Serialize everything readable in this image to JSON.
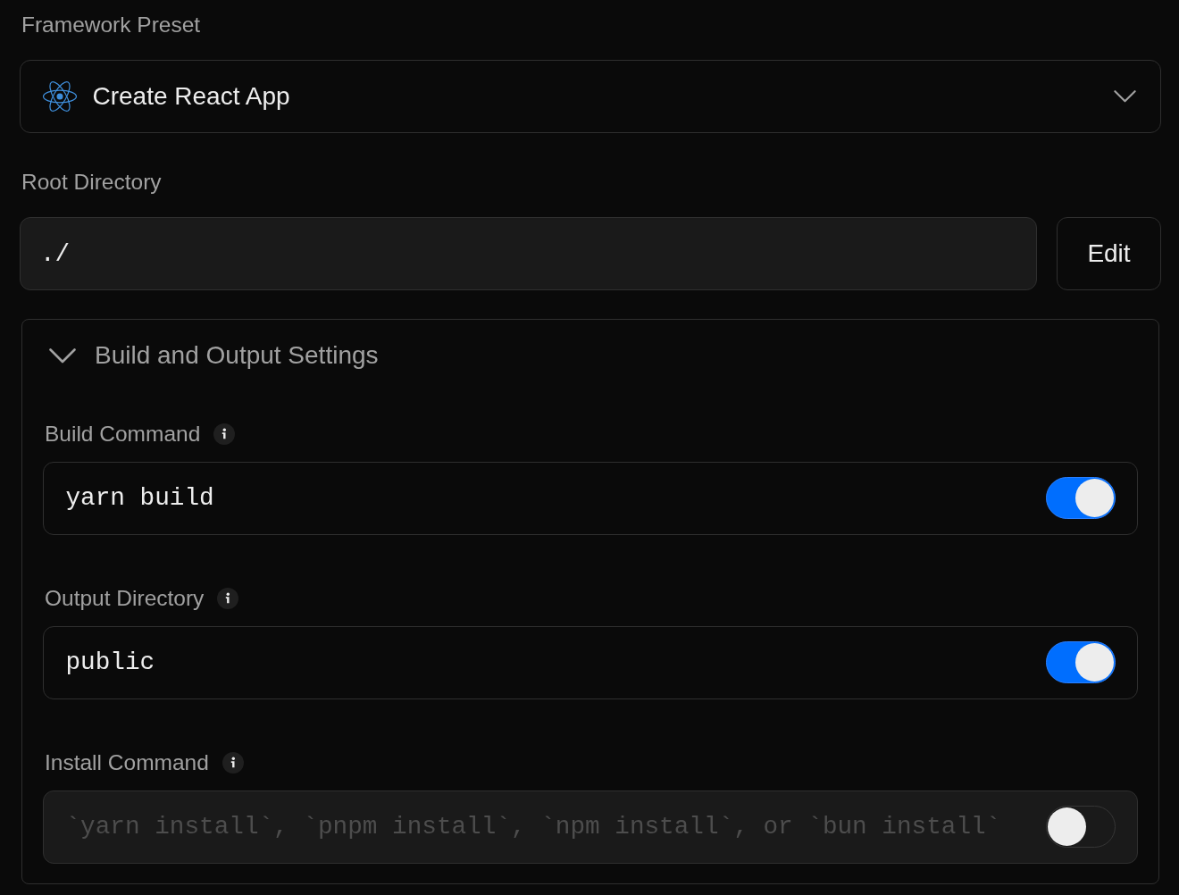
{
  "framework_preset": {
    "label": "Framework Preset",
    "value": "Create React App"
  },
  "root_directory": {
    "label": "Root Directory",
    "value": "./",
    "button": "Edit"
  },
  "build_settings": {
    "title": "Build and Output Settings",
    "expanded": true,
    "fields": [
      {
        "label": "Build Command",
        "value": "yarn build",
        "on": true
      },
      {
        "label": "Output Directory",
        "value": "public",
        "on": true
      },
      {
        "label": "Install Command",
        "placeholder": "`yarn install`, `pnpm install`, `npm install`, or `bun install`",
        "on": false
      }
    ]
  }
}
